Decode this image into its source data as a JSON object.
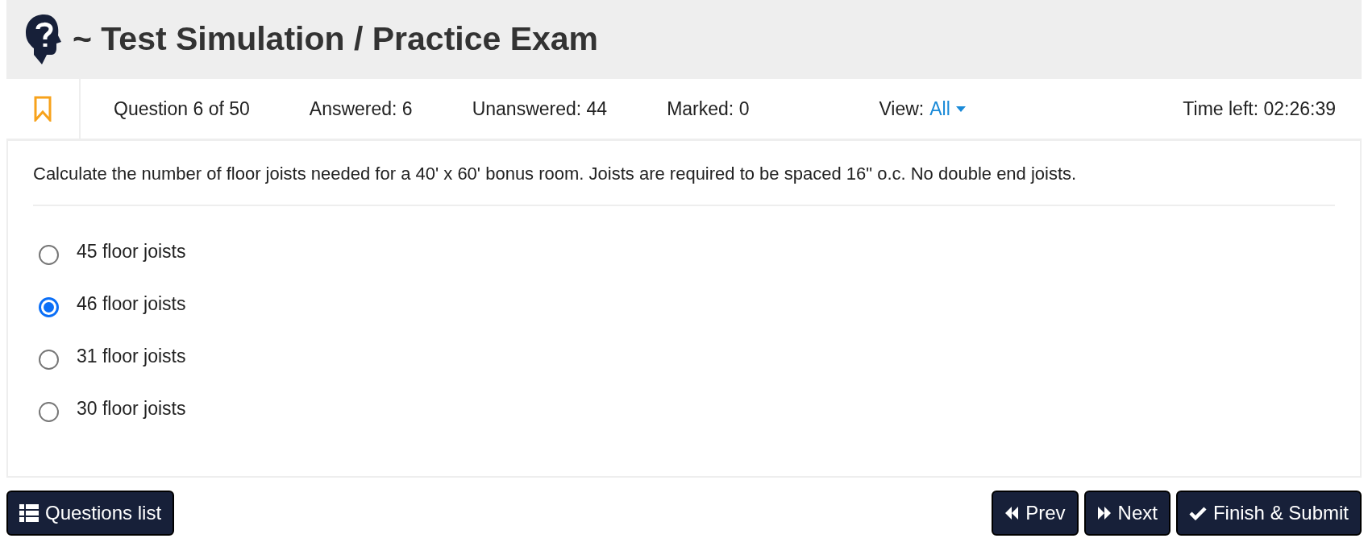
{
  "header": {
    "title": "~ Test Simulation / Practice Exam"
  },
  "status_bar": {
    "bookmark": {
      "marked": false
    },
    "question": "Question 6 of 50",
    "answered": "Answered: 6",
    "unanswered": "Unanswered: 44",
    "marked": "Marked: 0",
    "view_label": "View:",
    "view_value": "All",
    "time_left": "Time left: 02:26:39"
  },
  "question": {
    "text": "Calculate the number of floor joists needed for a 40' x 60' bonus room. Joists are required to be spaced 16\" o.c. No double end joists.",
    "options": [
      {
        "label": "45 floor joists",
        "selected": false
      },
      {
        "label": "46 floor joists",
        "selected": true
      },
      {
        "label": "31 floor joists",
        "selected": false
      },
      {
        "label": "30 floor joists",
        "selected": false
      }
    ]
  },
  "buttons": [
    {
      "kind": "list",
      "label": "Questions list"
    },
    {
      "kind": "prev",
      "label": "Prev"
    },
    {
      "kind": "next",
      "label": "Next"
    },
    {
      "kind": "finish",
      "label": "Finish & Submit"
    }
  ]
}
